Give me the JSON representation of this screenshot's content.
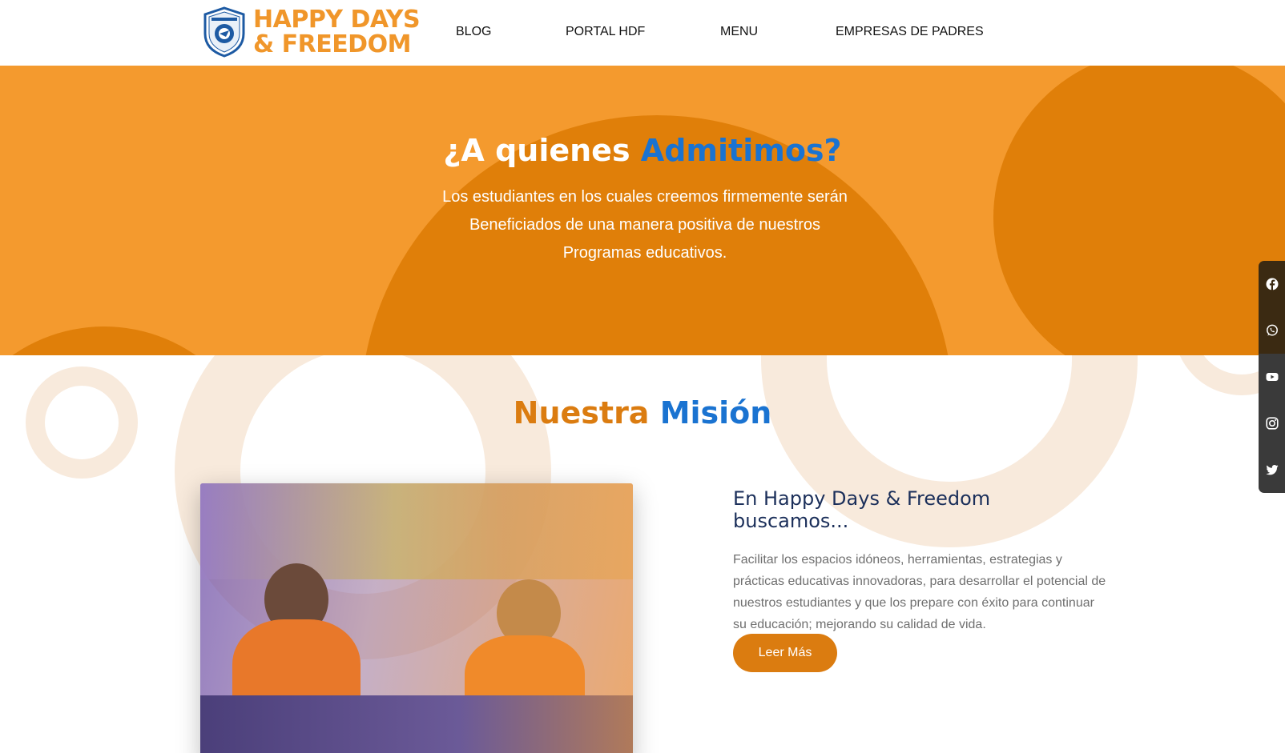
{
  "header": {
    "logo_line1": "HAPPY DAYS",
    "logo_line2": "& FREEDOM",
    "nav": [
      {
        "label": "BLOG",
        "icon": ""
      },
      {
        "label": "PORTAL HDF",
        "icon": ""
      },
      {
        "label": "MENU",
        "icon": ""
      },
      {
        "label": "EMPRESAS DE PADRES",
        "icon": ""
      }
    ]
  },
  "hero": {
    "title_part1": "¿A quienes ",
    "title_part2": "Admitimos?",
    "paragraph_lines": [
      "Los estudiantes en los cuales creemos firmemente serán",
      "Beneficiados de una manera positiva de nuestros",
      "Programas educativos."
    ]
  },
  "mission": {
    "title_part1": "Nuestra ",
    "title_part2": "Misión",
    "heading": "En Happy Days & Freedom buscamos...",
    "body": "Facilitar los espacios idóneos, herramientas, estrategias y prácticas educativas innovadoras, para desarrollar el potencial de nuestros estudiantes y que los prepare con éxito para continuar su educación; mejorando su calidad de vida.",
    "button_label": "Leer Más"
  },
  "social": [
    {
      "icon": "facebook-icon"
    },
    {
      "icon": "whatsapp-icon"
    },
    {
      "icon": "youtube-icon"
    },
    {
      "icon": "instagram-icon"
    },
    {
      "icon": "twitter-icon"
    }
  ],
  "colors": {
    "brand_orange": "#f49a2e",
    "dark_orange": "#db7c10",
    "accent_blue": "#1a73d1",
    "heading_navy": "#1b2f5a"
  }
}
